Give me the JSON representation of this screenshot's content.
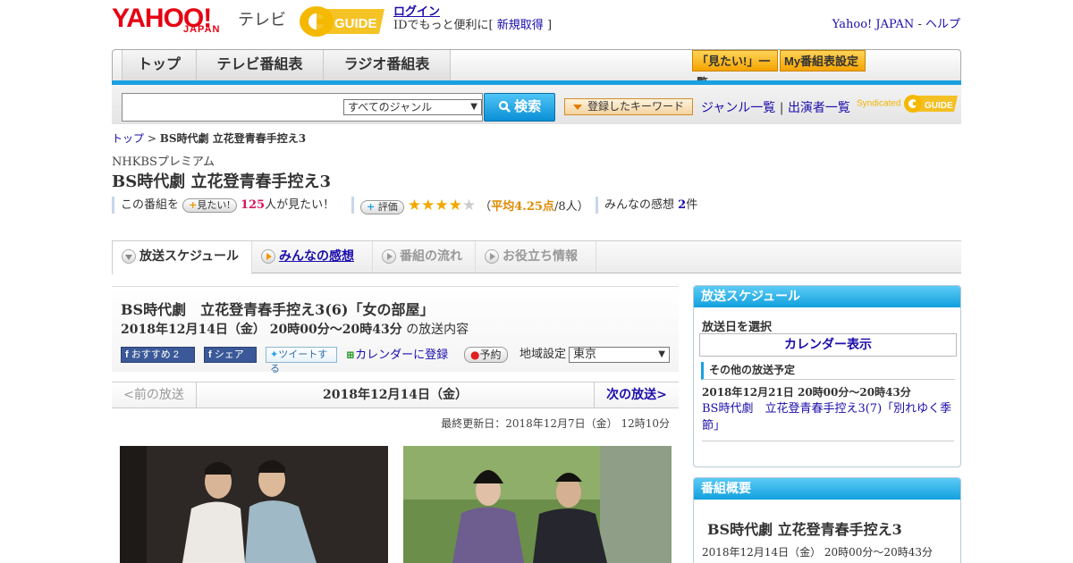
{
  "header": {
    "logo_yahoo": "YAHOO!",
    "logo_japan": "JAPAN",
    "logo_tv": "テレビ",
    "login_link": "ログイン",
    "login_sub_prefix": "IDでもっと便利に[",
    "register_link": "新規取得",
    "login_sub_suffix": "]",
    "yahoo_japan_link": "Yahoo! JAPAN",
    "separator": "-",
    "help_link": "ヘルプ"
  },
  "nav": {
    "tabs": [
      "トップ",
      "テレビ番組表",
      "ラジオ番組表"
    ],
    "mitai_list": "「見たい!」一覧",
    "my_schedule": "My番組表設定"
  },
  "search": {
    "genre_selected": "すべてのジャンル",
    "search_button": "検索",
    "registered_keyword": "登録したキーワード",
    "genre_list": "ジャンル一覧",
    "link_separator": "|",
    "performer_list": "出演者一覧",
    "syndicated": "Syndicated"
  },
  "breadcrumb": {
    "home": "トップ",
    "separator": ">",
    "current": "BS時代劇 立花登青春手控え3"
  },
  "program": {
    "channel": "NHKBSプレミアム",
    "title": "BS時代劇 立花登青春手控え3",
    "mitai_prefix": "この番組を",
    "mitai_pill": "見たい!",
    "mitai_count": "125",
    "mitai_suffix": "人が見たい！",
    "rating_pill": "評価",
    "rating_value": 4.25,
    "rating_open": "（",
    "rating_avg": "平均4.25点",
    "rating_people": "/8人）",
    "review_label": "みんなの感想",
    "review_count": "2",
    "review_unit": "件"
  },
  "detail_tabs": [
    {
      "label": "放送スケジュール",
      "state": "active"
    },
    {
      "label": "みんなの感想",
      "state": "link"
    },
    {
      "label": "番組の流れ",
      "state": "disabled"
    },
    {
      "label": "お役立ち情報",
      "state": "disabled"
    }
  ],
  "episode": {
    "title": "BS時代劇　立花登青春手控え3(6)「女の部屋」",
    "date": "2018年12月14日（金）  20時00分～20時43分",
    "date_suffix": "の放送内容",
    "recommend": "おすすめ",
    "recommend_count": "2",
    "share": "シェア",
    "tweet": "ツイートする",
    "calendar": "カレンダーに登録",
    "reserve": "予約",
    "region_label": "地域設定",
    "region_value": "東京"
  },
  "date_nav": {
    "prev": "<前の放送",
    "current": "2018年12月14日（金）",
    "next": "次の放送>"
  },
  "updated": "最終更新日：2018年12月7日（金）  12時10分",
  "sidebar": {
    "schedule_title": "放送スケジュール",
    "select_date": "放送日を選択",
    "calendar_link": "カレンダー表示",
    "other_label": "その他の放送予定",
    "other_date": "2018年12月21日  20時00分～20時43分",
    "other_link": "BS時代劇　立花登青春手控え3(7)「別れゆく季節」",
    "overview_title": "番組概要",
    "overview_program": "BS時代劇 立花登青春手控え3",
    "overview_date": "2018年12月14日（金）  20時00分～20時43分"
  },
  "colors": {
    "yahoo_red": "#e60012",
    "nav_blue": "#1aa0e0",
    "link": "#1a0dab",
    "orange": "#f29600",
    "star": "#f0a800"
  }
}
